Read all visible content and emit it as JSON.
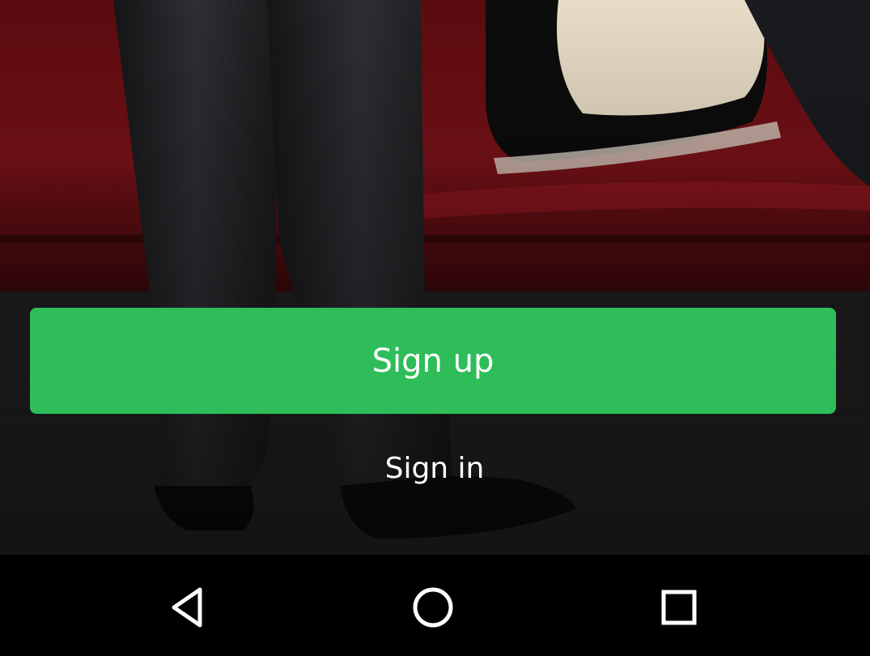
{
  "auth": {
    "signup_label": "Sign up",
    "signin_label": "Sign in"
  },
  "colors": {
    "signup_button": "#2ebd59",
    "navbar": "#000000",
    "text": "#ffffff"
  },
  "navbar": {
    "icons": [
      "back-triangle-icon",
      "home-circle-icon",
      "recents-square-icon"
    ]
  }
}
